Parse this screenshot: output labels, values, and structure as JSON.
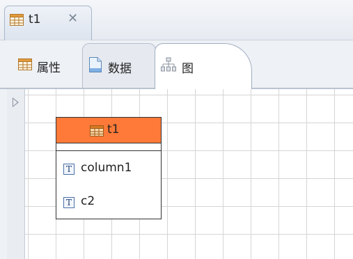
{
  "editor": {
    "tab_title": "t1",
    "tab_close_glyph": "✕"
  },
  "sub_tabs": [
    {
      "label": "属性",
      "icon": "table-icon",
      "active": false
    },
    {
      "label": "数据",
      "icon": "document-icon",
      "active": false
    },
    {
      "label": "图",
      "icon": "hierarchy-diagram-icon",
      "active": true
    }
  ],
  "diagram": {
    "entity": {
      "name": "t1",
      "header_color": "#ff7a38",
      "columns": [
        {
          "type_glyph": "T",
          "name": "column1"
        },
        {
          "type_glyph": "T",
          "name": "c2"
        }
      ]
    }
  },
  "colors": {
    "accent": "#ff7a38",
    "grid": "#d5d5d5"
  }
}
